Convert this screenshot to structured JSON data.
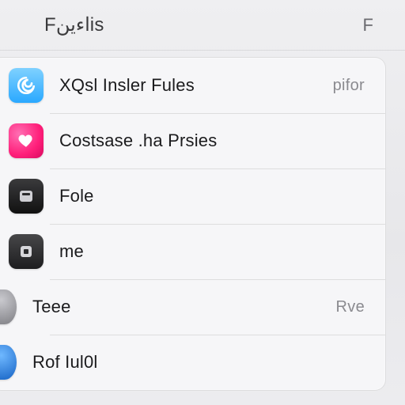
{
  "header": {
    "title": "Fاءینis",
    "right_label": "F"
  },
  "rows": [
    {
      "label": "XQsl Insler Fules",
      "value": "pifor",
      "icon": "spiral-icon"
    },
    {
      "label": "Costsase .ha Prsies",
      "value": "",
      "icon": "heart-icon"
    },
    {
      "label": "Fole",
      "value": "",
      "icon": "tile-icon"
    },
    {
      "label": "me",
      "value": "",
      "icon": "chip-icon"
    },
    {
      "label": "Teee",
      "value": "Rve",
      "icon": "orb-gray-icon"
    },
    {
      "label": "Rof Iul0l",
      "value": "",
      "icon": "orb-blue-icon"
    }
  ]
}
